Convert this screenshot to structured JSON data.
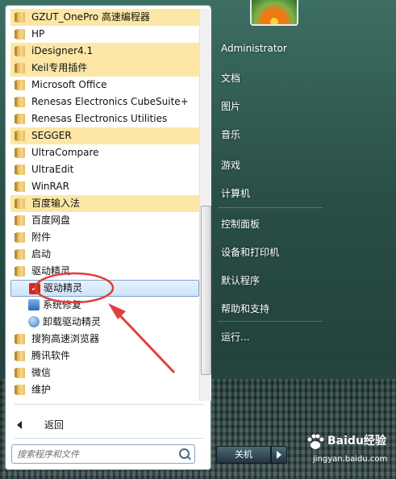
{
  "programs": [
    {
      "label": "GZUT_OnePro 高速编程器",
      "highlight": true,
      "type": "folder"
    },
    {
      "label": "HP",
      "highlight": false,
      "type": "folder"
    },
    {
      "label": "iDesigner4.1",
      "highlight": true,
      "type": "folder"
    },
    {
      "label": "Keil专用插件",
      "highlight": true,
      "type": "folder"
    },
    {
      "label": "Microsoft Office",
      "highlight": false,
      "type": "folder"
    },
    {
      "label": "Renesas Electronics CubeSuite+",
      "highlight": false,
      "type": "folder"
    },
    {
      "label": "Renesas Electronics Utilities",
      "highlight": false,
      "type": "folder"
    },
    {
      "label": "SEGGER",
      "highlight": true,
      "type": "folder"
    },
    {
      "label": "UltraCompare",
      "highlight": false,
      "type": "folder"
    },
    {
      "label": "UltraEdit",
      "highlight": false,
      "type": "folder"
    },
    {
      "label": "WinRAR",
      "highlight": false,
      "type": "folder"
    },
    {
      "label": "百度输入法",
      "highlight": true,
      "type": "folder"
    },
    {
      "label": "百度网盘",
      "highlight": false,
      "type": "folder"
    },
    {
      "label": "附件",
      "highlight": false,
      "type": "folder"
    },
    {
      "label": "启动",
      "highlight": false,
      "type": "folder"
    },
    {
      "label": "驱动精灵",
      "highlight": false,
      "type": "folder"
    },
    {
      "label": "驱动精灵",
      "highlight": false,
      "type": "app",
      "icon": "driver-genius-icon",
      "selected": true
    },
    {
      "label": "系统修复",
      "highlight": false,
      "type": "app",
      "icon": "system-repair-icon"
    },
    {
      "label": "卸载驱动精灵",
      "highlight": false,
      "type": "app",
      "icon": "uninstall-icon"
    },
    {
      "label": "搜狗高速浏览器",
      "highlight": false,
      "type": "folder"
    },
    {
      "label": "腾讯软件",
      "highlight": false,
      "type": "folder"
    },
    {
      "label": "微信",
      "highlight": false,
      "type": "folder"
    },
    {
      "label": "维护",
      "highlight": false,
      "type": "folder"
    }
  ],
  "back": {
    "label": "返回"
  },
  "search": {
    "placeholder": "搜索程序和文件"
  },
  "right_menu": {
    "user": "Administrator",
    "documents": "文档",
    "pictures": "图片",
    "music": "音乐",
    "games": "游戏",
    "computer": "计算机",
    "control_panel": "控制面板",
    "devices_printers": "设备和打印机",
    "default_programs": "默认程序",
    "help_support": "帮助和支持",
    "run": "运行..."
  },
  "shutdown": {
    "label": "关机"
  },
  "watermark": {
    "main": "Baidu经验",
    "sub": "jingyan.baidu.com"
  },
  "colors": {
    "highlight": "#fce7a6",
    "annotation": "#e0403e",
    "selected": "#cde4f8"
  }
}
